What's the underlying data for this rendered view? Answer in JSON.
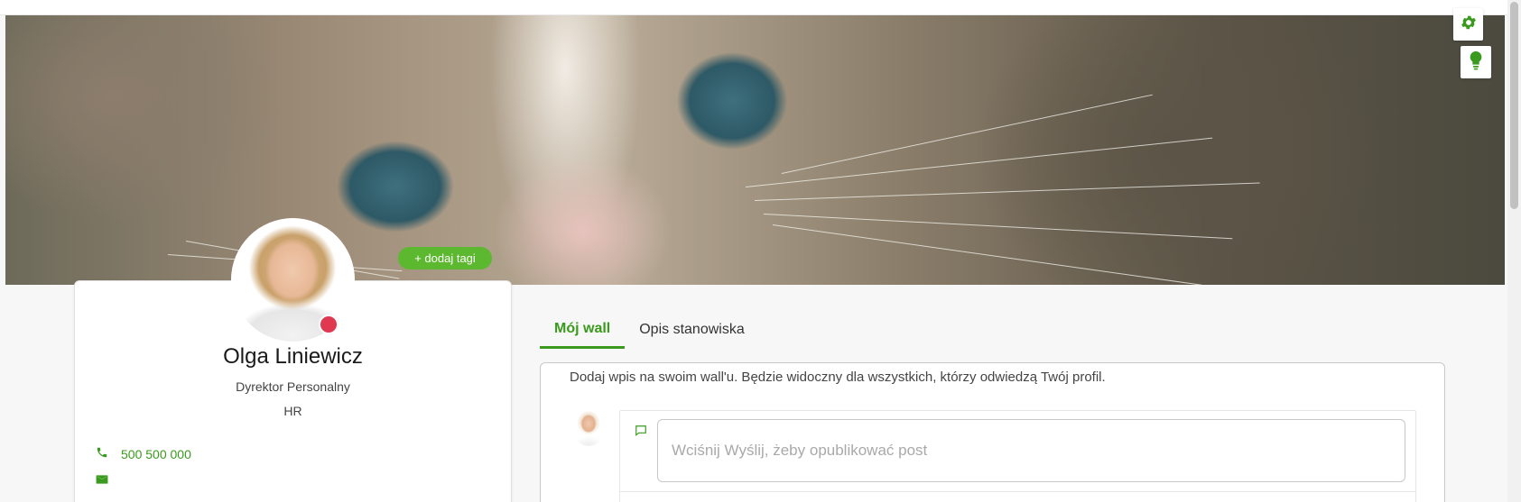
{
  "colors": {
    "accent": "#3a9a1d",
    "tag_button": "#5cb82e",
    "status_busy": "#e0384f"
  },
  "header": {
    "settings_icon": "gear-icon",
    "hint_icon": "lightbulb-icon"
  },
  "banner": {
    "tag_button_label": "+ dodaj tagi"
  },
  "profile": {
    "name": "Olga Liniewicz",
    "role": "Dyrektor Personalny",
    "department": "HR",
    "status": "busy",
    "phone": "500 500 000",
    "phone_icon": "phone-icon",
    "email_icon": "mail-icon"
  },
  "tabs": [
    {
      "label": "Mój wall",
      "active": true
    },
    {
      "label": "Opis stanowiska",
      "active": false
    }
  ],
  "wall": {
    "hint": "Dodaj wpis na swoim wall'u. Będzie widoczny dla wszystkich, którzy odwiedzą Twój profil.",
    "post_placeholder": "Wciśnij Wyślij, żeby opublikować post",
    "comment_icon": "comment-icon"
  }
}
